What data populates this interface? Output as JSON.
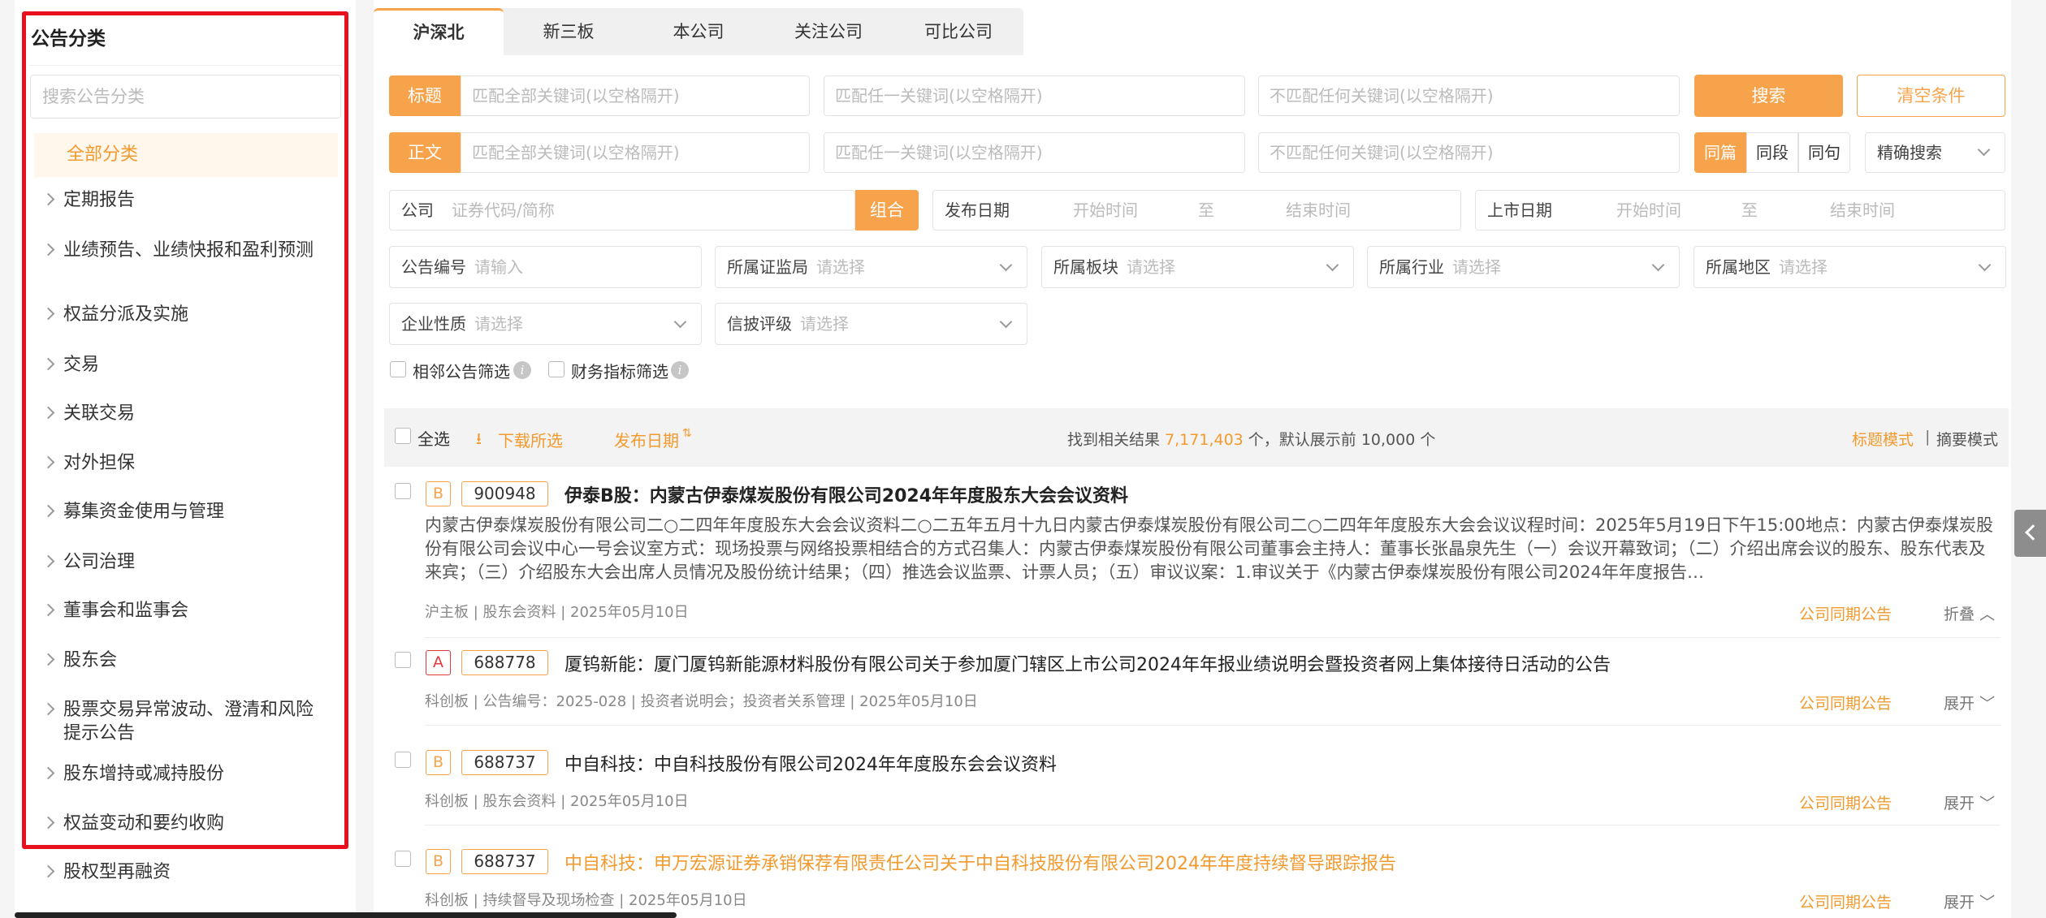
{
  "sidebar": {
    "title": "公告分类",
    "search_placeholder": "搜索公告分类",
    "all_label": "全部分类",
    "items": [
      {
        "label": "定期报告"
      },
      {
        "label": "业绩预告、业绩快报和盈利预测"
      },
      {
        "label": "权益分派及实施"
      },
      {
        "label": "交易"
      },
      {
        "label": "关联交易"
      },
      {
        "label": "对外担保"
      },
      {
        "label": "募集资金使用与管理"
      },
      {
        "label": "公司治理"
      },
      {
        "label": "董事会和监事会"
      },
      {
        "label": "股东会"
      },
      {
        "label": "股票交易异常波动、澄清和风险提示公告"
      },
      {
        "label": "股东增持或减持股份"
      },
      {
        "label": "权益变动和要约收购"
      },
      {
        "label": "股权型再融资"
      }
    ]
  },
  "tabs": [
    {
      "label": "沪深北"
    },
    {
      "label": "新三板"
    },
    {
      "label": "本公司"
    },
    {
      "label": "关注公司"
    },
    {
      "label": "可比公司"
    }
  ],
  "search": {
    "title_label": "标题",
    "body_label": "正文",
    "match_all_placeholder": "匹配全部关键词(以空格隔开)",
    "match_any_placeholder": "匹配任一关键词(以空格隔开)",
    "match_none_placeholder": "不匹配任何关键词(以空格隔开)",
    "search_button": "搜索",
    "clear_button": "清空条件",
    "scope_options": [
      "同篇",
      "同段",
      "同句"
    ],
    "scope_selected": "同篇",
    "precision_select": "精确搜索",
    "company_label": "公司",
    "company_placeholder": "证券代码/简称",
    "combo_button": "组合",
    "publish_date_label": "发布日期",
    "start_placeholder": "开始时间",
    "to": "至",
    "end_placeholder": "结束时间",
    "list_date_label": "上市日期",
    "notice_no_label": "公告编号",
    "notice_no_placeholder": "请输入",
    "select_placeholder": "请选择",
    "regulator_label": "所属证监局",
    "board_label": "所属板块",
    "industry_label": "所属行业",
    "region_label": "所属地区",
    "ownership_label": "企业性质",
    "rating_label": "信披评级",
    "adjacent_filter": "相邻公告筛选",
    "finance_filter": "财务指标筛选"
  },
  "results_bar": {
    "select_all": "全选",
    "download": "下载所选",
    "sort_label": "发布日期",
    "summary_prefix": "找到相关结果 ",
    "count": "7,171,403",
    "summary_suffix": " 个，默认展示前 10,000 个",
    "mode_title": "标题模式",
    "mode_divider": "|",
    "mode_abstract": "摘要模式"
  },
  "results": [
    {
      "badge": "B",
      "code": "900948",
      "title": "伊泰B股：内蒙古伊泰煤炭股份有限公司2024年年度股东大会会议资料",
      "excerpt": "内蒙古伊泰煤炭股份有限公司二○二四年年度股东大会会议资料二○二五年五月十九日内蒙古伊泰煤炭股份有限公司二○二四年年度股东大会会议议程时间：2025年5月19日下午15:00地点：内蒙古伊泰煤炭股份有限公司会议中心一号会议室方式：现场投票与网络投票相结合的方式召集人：内蒙古伊泰煤炭股份有限公司董事会主持人：董事长张晶泉先生（一）会议开幕致词；（二）介绍出席会议的股东、股东代表及来宾；（三）介绍股东大会出席人员情况及股份统计结果；（四）推选会议监票、计票人员；（五）审议议案：1.审议关于《内蒙古伊泰煤炭股份有限公司2024年年度报告…",
      "meta": "沪主板 | 股东会资料 | 2025年05月10日",
      "link": "公司同期公告",
      "toggle": "折叠"
    },
    {
      "badge": "A",
      "code": "688778",
      "title": "厦钨新能：厦门厦钨新能源材料股份有限公司关于参加厦门辖区上市公司2024年年报业绩说明会暨投资者网上集体接待日活动的公告",
      "meta": "科创板 | 公告编号：2025-028 | 投资者说明会；投资者关系管理 | 2025年05月10日",
      "link": "公司同期公告",
      "toggle": "展开"
    },
    {
      "badge": "B",
      "code": "688737",
      "title": "中自科技：中自科技股份有限公司2024年年度股东会会议资料",
      "meta": "科创板 | 股东会资料 | 2025年05月10日",
      "link": "公司同期公告",
      "toggle": "展开"
    },
    {
      "badge": "B",
      "code": "688737",
      "title": "中自科技：申万宏源证券承销保荐有限责任公司关于中自科技股份有限公司2024年年度持续督导跟踪报告",
      "meta": "科创板 | 持续督导及现场检查 | 2025年05月10日",
      "link": "公司同期公告",
      "toggle": "展开"
    }
  ],
  "colors": {
    "accent": "#f7a34b",
    "highlight_box": "#e8101c"
  }
}
